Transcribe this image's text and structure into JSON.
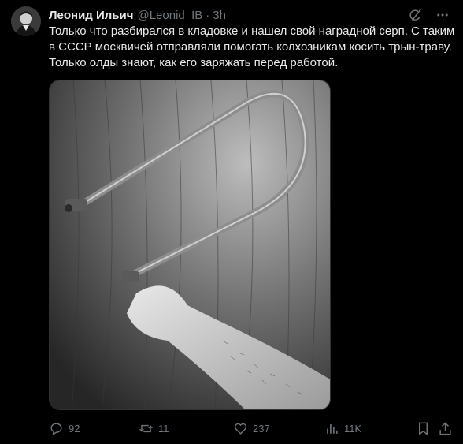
{
  "author": {
    "name": "Леонид Ильич",
    "handle": "@Leonid_IB",
    "separator": "·",
    "time": "3h"
  },
  "tweet": {
    "text": "Только что разбирался в кладовке и нашел свой наградной серп. С таким в СССР москвичей отправляли помогать колхозникам косить трын-траву. Только олды знают, как его заряжать перед работой."
  },
  "stats": {
    "replies": "92",
    "reposts": "11",
    "likes": "237",
    "views": "11K"
  },
  "colors": {
    "background": "#000000",
    "text": "#e7e9ea",
    "secondary": "#71767b"
  },
  "icons": {
    "grok": "grok-icon",
    "more": "more-icon",
    "reply": "reply-icon",
    "repost": "repost-icon",
    "like": "like-icon",
    "views": "views-icon",
    "bookmark": "bookmark-icon",
    "share": "share-icon"
  }
}
